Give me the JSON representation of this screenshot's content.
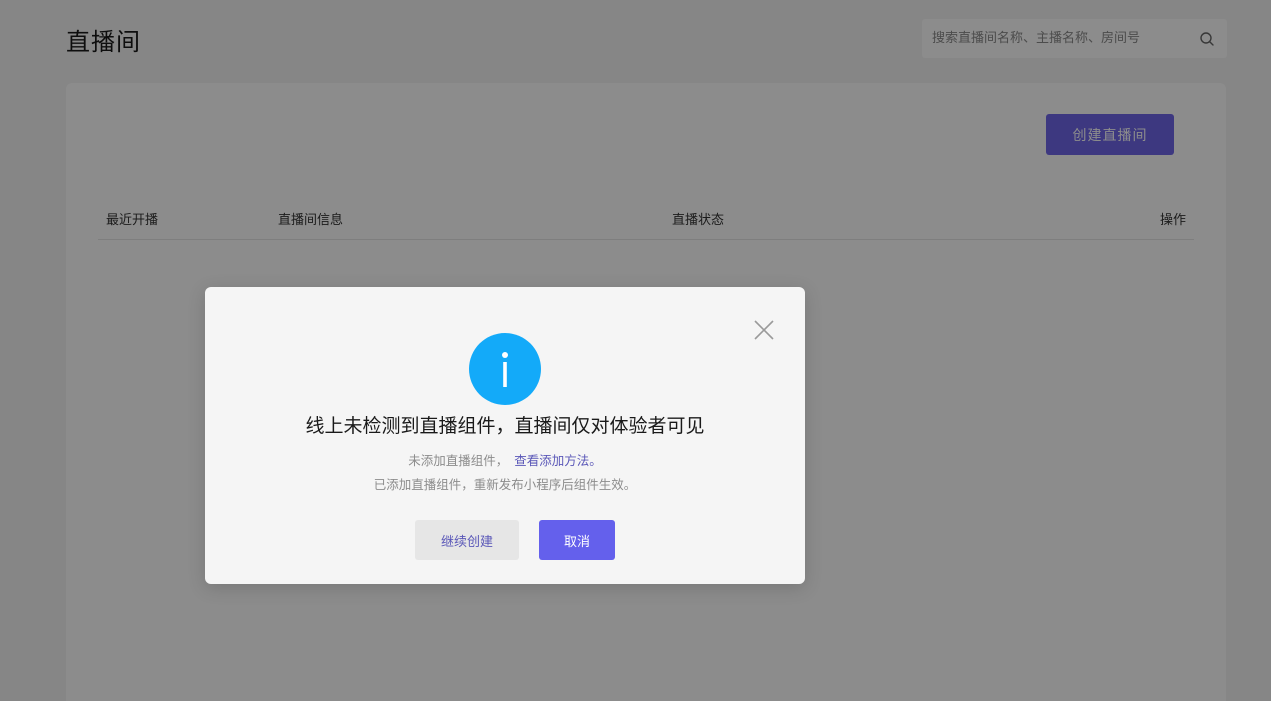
{
  "header": {
    "title": "直播间",
    "search_placeholder": "搜索直播间名称、主播名称、房间号",
    "search_value": "",
    "search_icon": "search-icon"
  },
  "main": {
    "create_button": "创建直播间",
    "table": {
      "columns": [
        "最近开播",
        "直播间信息",
        "直播状态",
        "操作"
      ],
      "rows": []
    }
  },
  "dialog": {
    "icon": "info-icon",
    "close_icon": "close-icon",
    "title": "线上未检测到直播组件，直播间仅对体验者可见",
    "line1_text": "未添加直播组件，",
    "line1_link": "查看添加方法。",
    "line2_text": "已添加直播组件，重新发布小程序后组件生效。",
    "continue_button": "继续创建",
    "cancel_button": "取消"
  },
  "colors": {
    "accent": "#6460ec",
    "link": "#5b58b8",
    "info": "#13aaf9",
    "overlay": "rgba(0,0,0,0.45)"
  }
}
